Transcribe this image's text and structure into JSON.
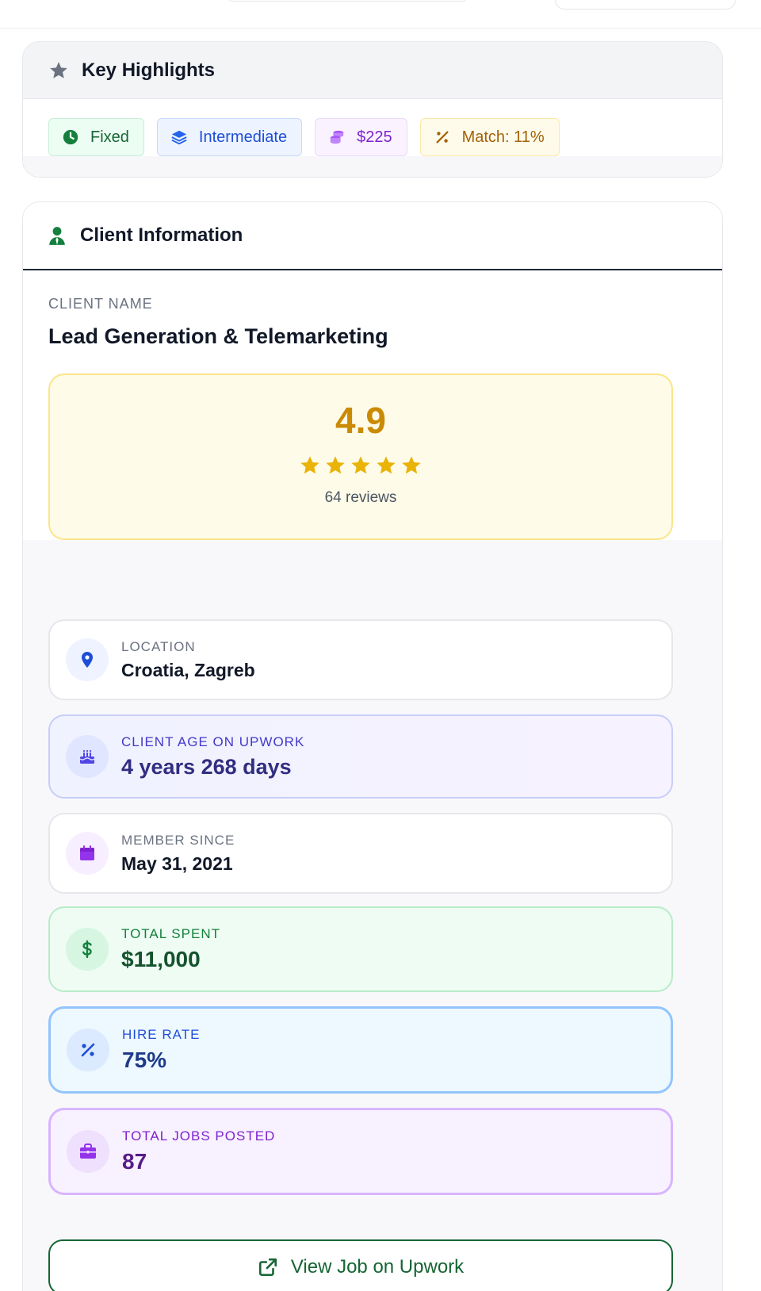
{
  "highlights": {
    "title": "Key Highlights",
    "chips": {
      "type": "Fixed",
      "level": "Intermediate",
      "budget": "$225",
      "match": "Match: 11%"
    }
  },
  "client": {
    "section_title": "Client Information",
    "name_label": "CLIENT NAME",
    "name": "Lead Generation & Telemarketing",
    "rating": {
      "score": "4.9",
      "stars": 5,
      "reviews": "64 reviews"
    },
    "stats": {
      "location": {
        "label": "LOCATION",
        "value": "Croatia, Zagreb"
      },
      "age": {
        "label": "CLIENT AGE ON UPWORK",
        "value": "4 years 268 days"
      },
      "member": {
        "label": "MEMBER SINCE",
        "value": "May 31, 2021"
      },
      "spent": {
        "label": "TOTAL SPENT",
        "value": "$11,000"
      },
      "hire": {
        "label": "HIRE RATE",
        "value": "75%"
      },
      "jobs": {
        "label": "TOTAL JOBS POSTED",
        "value": "87"
      }
    },
    "view_button": "View Job on Upwork"
  },
  "colors": {
    "rating_accent": "#ca8a04",
    "star": "#eab308",
    "brand_green": "#166534"
  },
  "icons": [
    "star-icon",
    "clock-icon",
    "layers-icon",
    "coins-icon",
    "percent-icon",
    "user-tie-icon",
    "location-pin-icon",
    "cake-icon",
    "calendar-icon",
    "dollar-icon",
    "briefcase-icon",
    "external-link-icon"
  ]
}
